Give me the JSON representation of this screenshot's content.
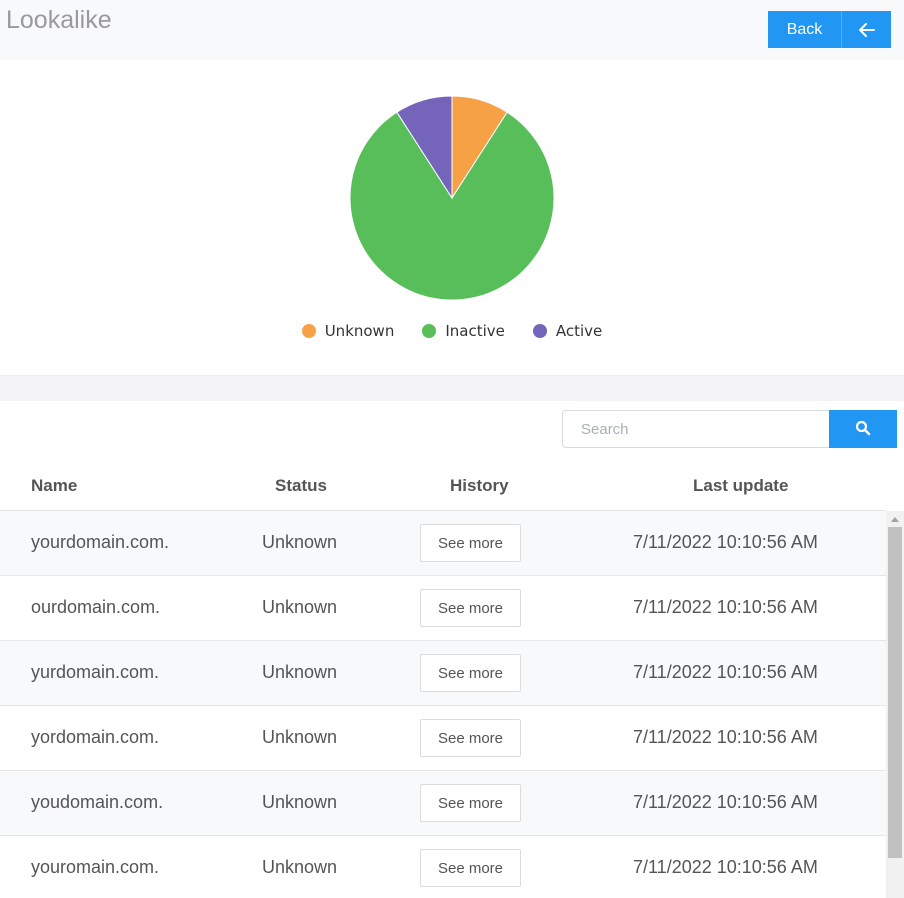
{
  "header": {
    "title": "Lookalike",
    "back_label": "Back"
  },
  "icons": {
    "back": "arrow-left-icon",
    "search": "search-icon",
    "scroll_up": "chevron-up-icon"
  },
  "colors": {
    "accent": "#2196f3",
    "unknown": "#f7a147",
    "inactive": "#57be5a",
    "active": "#7465bb"
  },
  "chart_data": {
    "type": "pie",
    "categories": [
      "Unknown",
      "Inactive",
      "Active"
    ],
    "values": [
      6,
      54,
      6
    ],
    "colors": [
      "#f7a147",
      "#57be5a",
      "#7465bb"
    ],
    "legend": "bottom"
  },
  "search": {
    "placeholder": "Search",
    "value": ""
  },
  "table": {
    "columns": [
      "Name",
      "Status",
      "History",
      "Last update"
    ],
    "rows": [
      {
        "name": "yourdomain.com.",
        "status": "Unknown",
        "history": "See more",
        "updated": "7/11/2022 10:10:56 AM"
      },
      {
        "name": "ourdomain.com.",
        "status": "Unknown",
        "history": "See more",
        "updated": "7/11/2022 10:10:56 AM"
      },
      {
        "name": "yurdomain.com.",
        "status": "Unknown",
        "history": "See more",
        "updated": "7/11/2022 10:10:56 AM"
      },
      {
        "name": "yordomain.com.",
        "status": "Unknown",
        "history": "See more",
        "updated": "7/11/2022 10:10:56 AM"
      },
      {
        "name": "youdomain.com.",
        "status": "Unknown",
        "history": "See more",
        "updated": "7/11/2022 10:10:56 AM"
      },
      {
        "name": "youromain.com.",
        "status": "Unknown",
        "history": "See more",
        "updated": "7/11/2022 10:10:56 AM"
      }
    ]
  }
}
